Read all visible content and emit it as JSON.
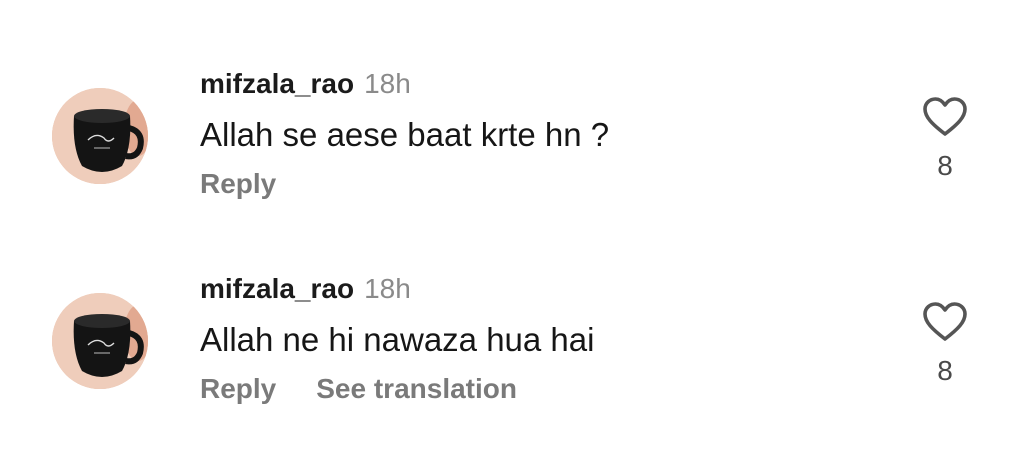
{
  "comments": [
    {
      "username": "mifzala_rao",
      "time": "18h",
      "text": "Allah se aese baat krte hn ?",
      "reply_label": "Reply",
      "like_count": "8",
      "icons": {
        "avatar": "mug-photo-avatar",
        "like": "heart-outline-icon"
      }
    },
    {
      "username": "mifzala_rao",
      "time": "18h",
      "text": "Allah ne hi nawaza hua hai",
      "reply_label": "Reply",
      "translate_label": "See translation",
      "like_count": "8",
      "icons": {
        "avatar": "mug-photo-avatar",
        "like": "heart-outline-icon"
      }
    }
  ],
  "colors": {
    "username": "#1b1b1b",
    "meta": "#8a8a8a",
    "action": "#7a7a7a",
    "icon": "#555555"
  }
}
